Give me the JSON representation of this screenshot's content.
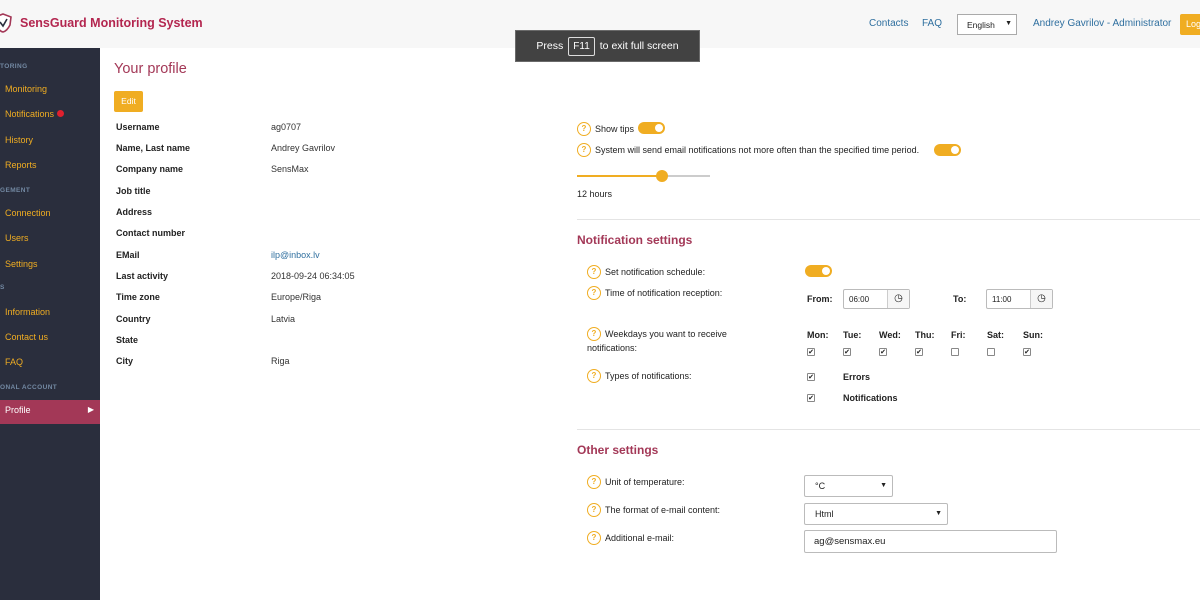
{
  "header": {
    "app_title": "SensGuard Monitoring System",
    "contacts": "Contacts",
    "faq": "FAQ",
    "language": "English",
    "user": "Andrey Gavrilov - Administrator",
    "logout": "Log"
  },
  "fullscreen_toast": {
    "press": "Press",
    "key": "F11",
    "message": "to exit full screen"
  },
  "sidebar": {
    "sections": [
      "TORING",
      "GEMENT",
      "S",
      "ONAL ACCOUNT"
    ],
    "items": [
      {
        "label": "Monitoring"
      },
      {
        "label": "Notifications"
      },
      {
        "label": "History"
      },
      {
        "label": "Reports"
      },
      {
        "label": "Connection"
      },
      {
        "label": "Users"
      },
      {
        "label": "Settings"
      },
      {
        "label": "Information"
      },
      {
        "label": "Contact us"
      },
      {
        "label": "FAQ"
      },
      {
        "label": "Profile"
      }
    ]
  },
  "profile": {
    "title": "Your profile",
    "edit": "Edit",
    "fields": [
      {
        "label": "Username",
        "value": "ag0707"
      },
      {
        "label": "Name, Last name",
        "value": "Andrey Gavrilov"
      },
      {
        "label": "Company name",
        "value": "SensMax"
      },
      {
        "label": "Job title",
        "value": ""
      },
      {
        "label": "Address",
        "value": ""
      },
      {
        "label": "Contact number",
        "value": ""
      },
      {
        "label": "EMail",
        "value": "ilp@inbox.lv"
      },
      {
        "label": "Last activity",
        "value": "2018-09-24 06:34:05"
      },
      {
        "label": "Time zone",
        "value": "Europe/Riga"
      },
      {
        "label": "Country",
        "value": "Latvia"
      },
      {
        "label": "State",
        "value": ""
      },
      {
        "label": "City",
        "value": "Riga"
      }
    ]
  },
  "general_settings": {
    "show_tips": "Show tips",
    "show_tips_on": true,
    "email_period": "System will send email notifications not more often than the specified time period.",
    "email_period_on": true,
    "period_value": "12 hours",
    "period_fraction": 0.64
  },
  "notification_settings": {
    "title": "Notification settings",
    "schedule_label": "Set notification schedule:",
    "schedule_on": true,
    "reception_label": "Time of notification reception:",
    "from_label": "From:",
    "from_value": "06:00",
    "to_label": "To:",
    "to_value": "11:00",
    "weekdays_label_1": "Weekdays you want to receive",
    "weekdays_label_2": "notifications:",
    "days": [
      {
        "label": "Mon:",
        "checked": true
      },
      {
        "label": "Tue:",
        "checked": true
      },
      {
        "label": "Wed:",
        "checked": true
      },
      {
        "label": "Thu:",
        "checked": true
      },
      {
        "label": "Fri:",
        "checked": false
      },
      {
        "label": "Sat:",
        "checked": false
      },
      {
        "label": "Sun:",
        "checked": true
      }
    ],
    "types_label": "Types of notifications:",
    "types": [
      {
        "label": "Errors",
        "checked": true
      },
      {
        "label": "Notifications",
        "checked": true
      }
    ]
  },
  "other_settings": {
    "title": "Other settings",
    "temperature_label": "Unit of temperature:",
    "temperature_value": "°C",
    "email_format_label": "The format of e-mail content:",
    "email_format_value": "Html",
    "additional_email_label": "Additional e-mail:",
    "additional_email_value": "ag@sensmax.eu"
  },
  "help_icon_glyph": "?",
  "checkmark_glyph": "✔",
  "colors": {
    "accent": "#f0ad22",
    "brand": "#a33857",
    "sidebar": "#2a2e3d",
    "link": "#2f6f9f"
  }
}
